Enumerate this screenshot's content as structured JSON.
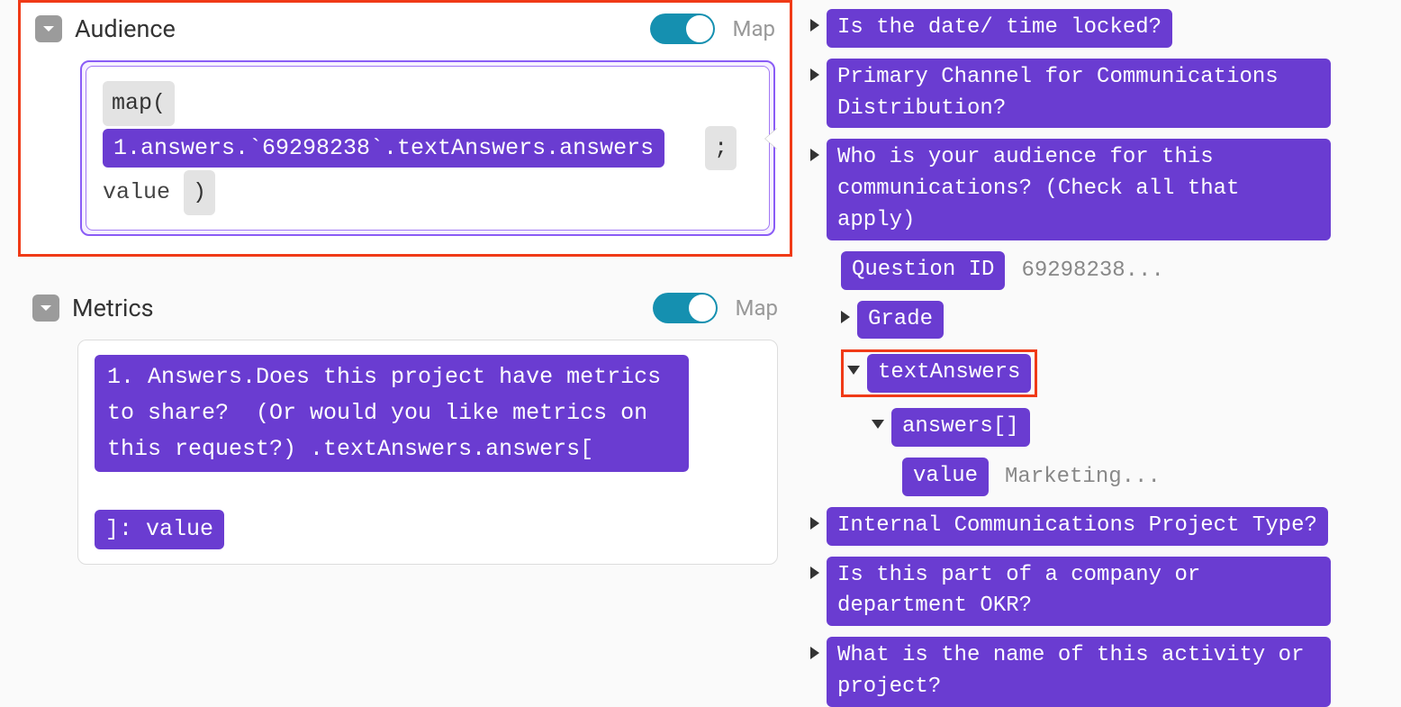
{
  "left": {
    "audience": {
      "title": "Audience",
      "toggle_label": "Map",
      "map_open": "map(",
      "path_chip": "1.answers.`69298238`.textAnswers.answers",
      "semicolon": ";",
      "value_text": "value",
      "paren_close": ")"
    },
    "metrics": {
      "title": "Metrics",
      "toggle_label": "Map",
      "block1": "1. Answers.Does this project have metrics to share?  (Or would you like metrics on this request?) .textAnswers.answers[",
      "block2": "]: value"
    }
  },
  "right": {
    "items": [
      {
        "label": "Is the date/ time locked?"
      },
      {
        "label": "Primary Channel for Communications Distribution?"
      },
      {
        "label": "Who is your audience for this communications? (Check all that apply)",
        "expanded": true
      }
    ],
    "qid_key": "Question ID",
    "qid_val": "69298238...",
    "grade": "Grade",
    "text_answers": "textAnswers",
    "answers_arr": "answers[]",
    "value_key": "value",
    "value_val": "Marketing...",
    "tail": [
      {
        "label": "Internal Communications Project Type?"
      },
      {
        "label": "Is this part of a company or department OKR?"
      },
      {
        "label": "What is the name of this activity or project?"
      }
    ]
  }
}
